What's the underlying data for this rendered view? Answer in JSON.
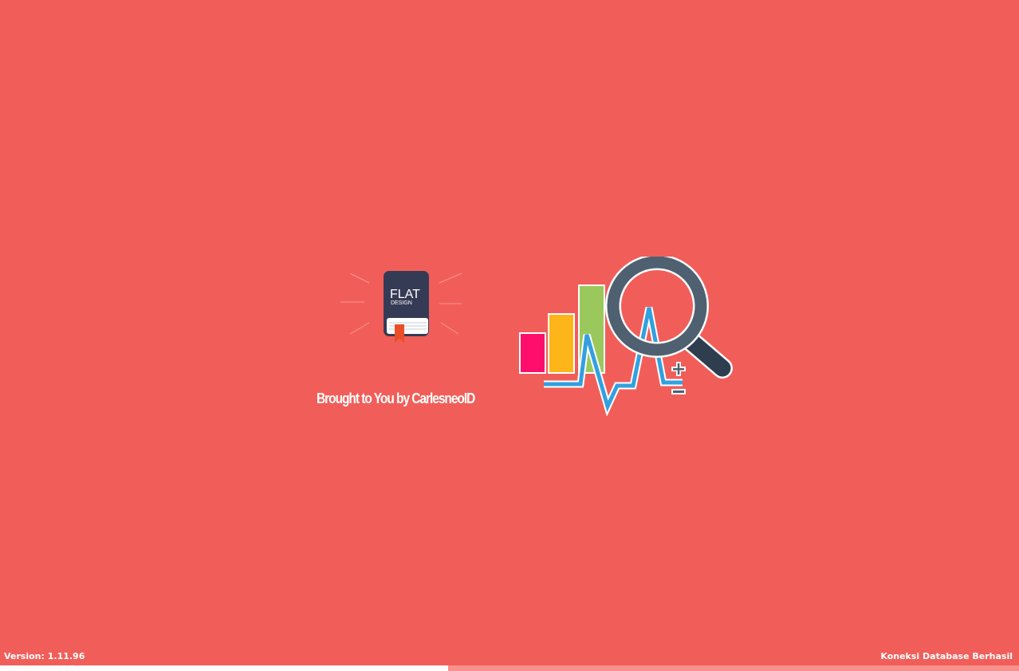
{
  "logo": {
    "line1": "FLAT",
    "line2": "DESIGN"
  },
  "credit": "Brought to You by CarlesneoID",
  "footer": {
    "version": "Version: 1.11.96",
    "status": "Koneksi Database Berhasil"
  },
  "progress": {
    "fraction": 0.44
  },
  "illustration": {
    "bars": [
      {
        "color": "#FF0F6B"
      },
      {
        "color": "#FDB51A"
      },
      {
        "color": "#9AC85C"
      }
    ],
    "line_color": "#33A0DF",
    "lens_color": "#4F6071",
    "handle_color": "#2E3E4F",
    "icons": [
      "bar-chart-icon",
      "pulse-line-icon",
      "magnifier-icon",
      "zoom-in-icon",
      "zoom-out-icon"
    ]
  },
  "colors": {
    "background": "#F15E59",
    "book_cover": "#353B54",
    "bookmark": "#E94E26",
    "progress_track": "#F8908B",
    "progress_fill": "#FFFFFF"
  }
}
